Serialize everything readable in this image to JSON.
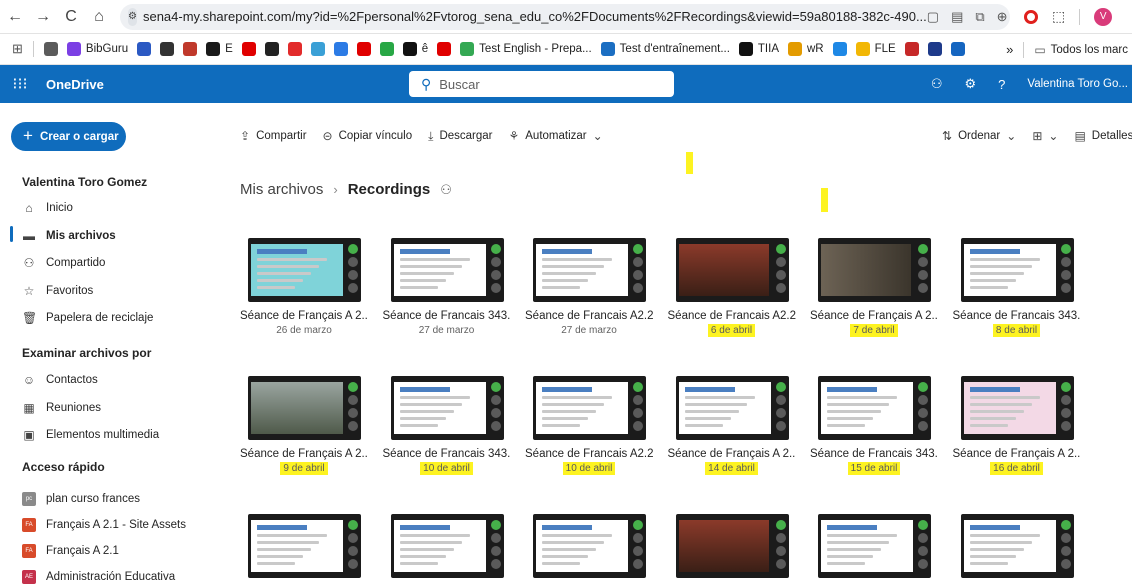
{
  "browser": {
    "url": "sena4-my.sharepoint.com/my?id=%2Fpersonal%2Fvtorog_sena_edu_co%2FDocuments%2FRecordings&viewid=59a80188-382c-490...",
    "nav": [
      "←",
      "→",
      "C",
      "⌂"
    ],
    "bookmarks": [
      {
        "label": "",
        "color": "#5b5b5b"
      },
      {
        "label": "BibGuru",
        "color": "#7b3fe4"
      },
      {
        "label": "",
        "color": "#2b59c3"
      },
      {
        "label": "",
        "color": "#333333"
      },
      {
        "label": "",
        "color": "#c0392b"
      },
      {
        "label": "E",
        "color": "#1a1a1a"
      },
      {
        "label": "",
        "color": "#e00000"
      },
      {
        "label": "",
        "color": "#222222"
      },
      {
        "label": "",
        "color": "#e22b2b"
      },
      {
        "label": "",
        "color": "#3aa0d6"
      },
      {
        "label": "",
        "color": "#2c7be5"
      },
      {
        "label": "",
        "color": "#e00000"
      },
      {
        "label": "",
        "color": "#28a745"
      },
      {
        "label": "ê",
        "color": "#111111"
      },
      {
        "label": "",
        "color": "#e00000"
      },
      {
        "label": "Test English - Prepa...",
        "color": "#34a853"
      },
      {
        "label": "Test d'entraînement...",
        "color": "#1b6ec2"
      },
      {
        "label": "TIIA",
        "color": "#111111"
      },
      {
        "label": "wR",
        "color": "#e39b00"
      },
      {
        "label": "",
        "color": "#1e88e5"
      },
      {
        "label": "FLE",
        "color": "#f2b705"
      },
      {
        "label": "",
        "color": "#c62828"
      },
      {
        "label": "",
        "color": "#1e3a8a"
      },
      {
        "label": "",
        "color": "#1565c0"
      }
    ],
    "more": "»",
    "all_bookmarks": "Todos los marc"
  },
  "suite": {
    "waffle": "⋮⋮⋮",
    "app_name": "OneDrive",
    "search_placeholder": "Buscar",
    "user": "Valentina Toro Go..."
  },
  "sidebar": {
    "create": "Crear o cargar",
    "user_name": "Valentina Toro Gomez",
    "main_items": [
      {
        "label": "Inicio",
        "icon": "⌂"
      },
      {
        "label": "Mis archivos",
        "icon": "▬"
      },
      {
        "label": "Compartido",
        "icon": "⚇"
      },
      {
        "label": "Favoritos",
        "icon": "☆"
      },
      {
        "label": "Papelera de reciclaje",
        "icon": "🗑"
      }
    ],
    "browse_title": "Examinar archivos por",
    "browse_items": [
      {
        "label": "Contactos",
        "icon": "☺"
      },
      {
        "label": "Reuniones",
        "icon": "▦"
      },
      {
        "label": "Elementos multimedia",
        "icon": "▣"
      }
    ],
    "quick_title": "Acceso rápido",
    "quick_items": [
      {
        "label": "plan curso frances",
        "badge": "pc",
        "color": "#8a8a8a"
      },
      {
        "label": "Français A 2.1 - Site Assets",
        "badge": "FA",
        "color": "#d84b2a"
      },
      {
        "label": "Français A 2.1",
        "badge": "FA",
        "color": "#d84b2a"
      },
      {
        "label": "Administración Educativa",
        "badge": "AE",
        "color": "#c4314b"
      }
    ]
  },
  "toolbar": {
    "share": "Compartir",
    "copy_link": "Copiar vínculo",
    "download": "Descargar",
    "automate": "Automatizar",
    "sort": "Ordenar",
    "view": "☷",
    "details": "Detalles"
  },
  "breadcrumb": {
    "parent": "Mis archivos",
    "current": "Recordings"
  },
  "files": [
    {
      "name": "Séance de Français A 2....",
      "date": "26 de marzo",
      "highlight": false,
      "thumb": "teal"
    },
    {
      "name": "Séance de Francais 343...",
      "date": "27 de marzo",
      "highlight": false,
      "thumb": "doc"
    },
    {
      "name": "Séance de Francais A2.2...",
      "date": "27 de marzo",
      "highlight": false,
      "thumb": "doc"
    },
    {
      "name": "Séance de Francais A2.2...",
      "date": "6 de abril",
      "highlight": true,
      "thumb": "cam"
    },
    {
      "name": "Séance de Français A 2....",
      "date": "7 de abril",
      "highlight": true,
      "thumb": "cam2"
    },
    {
      "name": "Séance de Francais 343...",
      "date": "8 de abril",
      "highlight": true,
      "thumb": "doc"
    },
    {
      "name": "Séance de Français A 2....",
      "date": "9 de abril",
      "highlight": true,
      "thumb": "photo"
    },
    {
      "name": "Séance de Francais 343...",
      "date": "10 de abril",
      "highlight": true,
      "thumb": "doc"
    },
    {
      "name": "Séance de Francais A2.2...",
      "date": "10 de abril",
      "highlight": true,
      "thumb": "doc"
    },
    {
      "name": "Séance de Français A 2....",
      "date": "14 de abril",
      "highlight": true,
      "thumb": "doc"
    },
    {
      "name": "Séance de Francais 343...",
      "date": "15 de abril",
      "highlight": true,
      "thumb": "doc"
    },
    {
      "name": "Séance de Français A 2....",
      "date": "16 de abril",
      "highlight": true,
      "thumb": "pink"
    },
    {
      "name": "",
      "date": "",
      "highlight": false,
      "thumb": "doc"
    },
    {
      "name": "",
      "date": "",
      "highlight": false,
      "thumb": "doc"
    },
    {
      "name": "",
      "date": "",
      "highlight": false,
      "thumb": "doc"
    },
    {
      "name": "",
      "date": "",
      "highlight": false,
      "thumb": "cam"
    },
    {
      "name": "",
      "date": "",
      "highlight": false,
      "thumb": "doc"
    },
    {
      "name": "",
      "date": "",
      "highlight": false,
      "thumb": "doc"
    }
  ]
}
